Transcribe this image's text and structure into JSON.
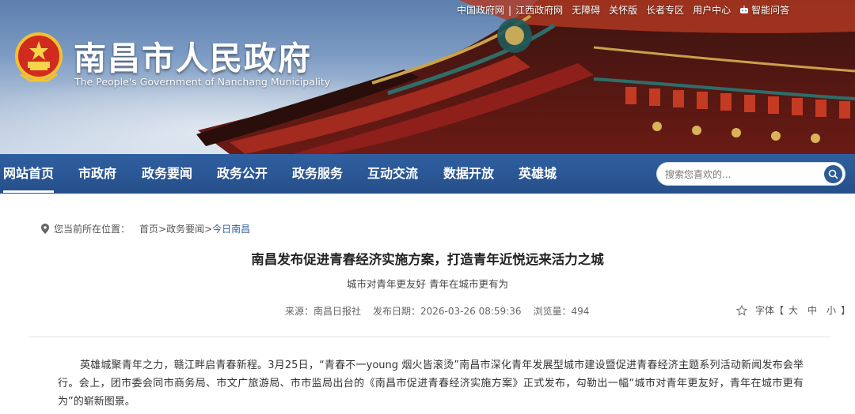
{
  "header": {
    "title": "南昌市人民政府",
    "subtitle": "The People's Government of Nanchang Municipality",
    "emblem_icon": "national-emblem-icon",
    "toplinks": [
      "中国政府网",
      "江西政府网",
      "无障碍",
      "关怀版",
      "长者专区",
      "用户中心",
      "智能问答"
    ]
  },
  "nav": {
    "items": [
      "网站首页",
      "市政府",
      "政务要闻",
      "政务公开",
      "政务服务",
      "互动交流",
      "数据开放",
      "英雄城"
    ],
    "active_index": 0,
    "search_placeholder": "搜索您喜欢的..."
  },
  "breadcrumb": {
    "label": "您当前所在位置：",
    "items": [
      "首页",
      "政务要闻",
      "今日南昌"
    ],
    "separator": ">"
  },
  "article": {
    "title": "南昌发布促进青春经济实施方案，打造青年近悦远来活力之城",
    "subtitle": "城市对青年更友好 青年在城市更有为",
    "meta": {
      "source": "来源：南昌日报社",
      "date": "发布日期：2026-03-26 08:59:36",
      "views": "浏览量：494"
    },
    "fontsize": {
      "label": "字体【",
      "options": [
        "大",
        "中",
        "小"
      ],
      "close": "】"
    },
    "paragraph": "英雄城聚青年之力，赣江畔启青春新程。3月25日，“青春不一young 烟火皆滚烫”南昌市深化青年发展型城市建设暨促进青春经济主题系列活动新闻发布会举行。会上，团市委会同市商务局、市文广旅游局、市市监局出台的《南昌市促进青春经济实施方案》正式发布，勾勒出一幅“城市对青年更友好，青年在城市更有为”的崭新图景。"
  },
  "colors": {
    "nav_bg": "#2b5893",
    "accent": "#2f5fa0",
    "banner_sky": "#7b9ac3",
    "roof_red": "#8e1f1a"
  }
}
